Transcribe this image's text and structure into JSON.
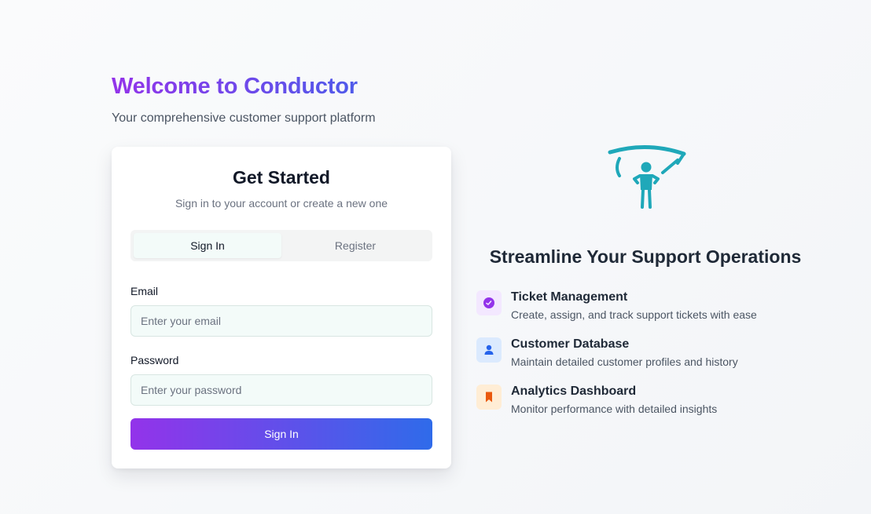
{
  "hero": {
    "title": "Welcome to Conductor",
    "subtitle": "Your comprehensive customer support platform"
  },
  "card": {
    "title": "Get Started",
    "description": "Sign in to your account or create a new one",
    "tabs": [
      {
        "label": "Sign In",
        "active": true
      },
      {
        "label": "Register",
        "active": false
      }
    ],
    "email": {
      "label": "Email",
      "placeholder": "Enter your email",
      "value": ""
    },
    "password": {
      "label": "Password",
      "placeholder": "Enter your password",
      "value": ""
    },
    "submit_label": "Sign In"
  },
  "logo": {
    "icon": "conductor-figure-icon",
    "color": "#1fa8b9"
  },
  "features": {
    "heading": "Streamline Your Support Operations",
    "items": [
      {
        "title": "Ticket Management",
        "description": "Create, assign, and track support tickets with ease",
        "icon": "ticket-check-icon",
        "icon_bg": "#f3e8ff",
        "icon_color": "#9333ea"
      },
      {
        "title": "Customer Database",
        "description": "Maintain detailed customer profiles and history",
        "icon": "user-icon",
        "icon_bg": "#dbeafe",
        "icon_color": "#2563eb"
      },
      {
        "title": "Analytics Dashboard",
        "description": "Monitor performance with detailed insights",
        "icon": "bookmark-icon",
        "icon_bg": "#ffedd5",
        "icon_color": "#ea580c"
      }
    ]
  },
  "colors": {
    "brand_purple": "#9333ea",
    "brand_blue": "#2f6bea",
    "teal_accent": "#1fa8b9"
  }
}
